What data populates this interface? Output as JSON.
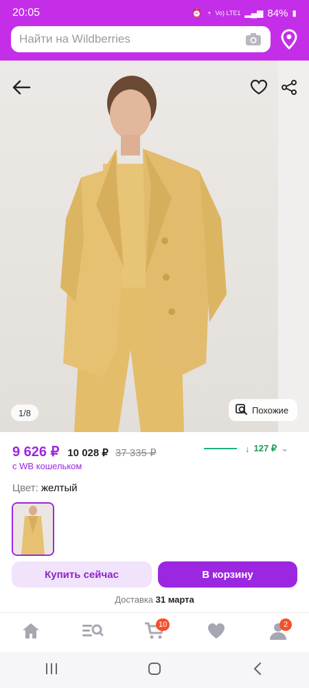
{
  "status_bar": {
    "time": "20:05",
    "network_label": "Vo) LTE1",
    "battery": "84%"
  },
  "search": {
    "placeholder": "Найти на Wildberries"
  },
  "gallery": {
    "counter": "1/8",
    "similar_label": "Похожие"
  },
  "price": {
    "current": "9 626 ₽",
    "alt": "10 028 ₽",
    "old": "37 335 ₽",
    "trend_value": "127 ₽",
    "wallet_note": "с WB кошельком"
  },
  "color": {
    "label": "Цвет:",
    "value": "желтый"
  },
  "actions": {
    "buy_now": "Купить сейчас",
    "add_to_cart": "В корзину",
    "delivery_label": "Доставка",
    "delivery_date": "31 марта"
  },
  "bottom_nav": {
    "cart_badge": "10",
    "profile_badge": "2"
  },
  "colors": {
    "brand": "#9b27e0",
    "header": "#c42ee8",
    "accent_green": "#1a9b55",
    "badge": "#f5512a"
  }
}
